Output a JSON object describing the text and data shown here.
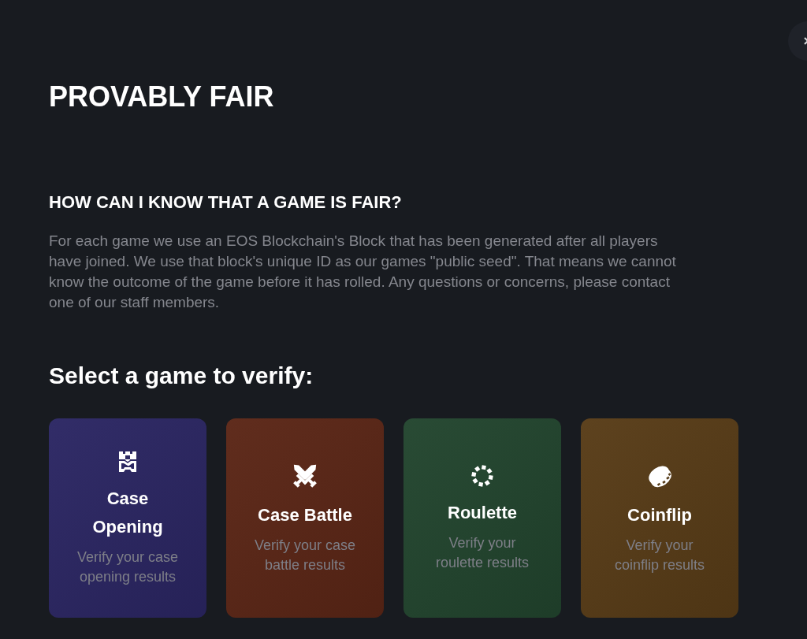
{
  "page": {
    "title": "PROVABLY FAIR"
  },
  "faq": {
    "heading": "HOW CAN I KNOW THAT A GAME IS FAIR?",
    "body": "For each game we use an EOS Blockchain's Block that has been generated after all players have joined. We use that block's unique ID as our games \"public seed\". That means we cannot know the outcome of the game before it has rolled. Any questions or concerns, please contact one of our staff members."
  },
  "games_heading": "Select a game to verify:",
  "games": [
    {
      "kind": "case",
      "title": "Case Opening",
      "description": "Verify your case opening results",
      "color": "#2b2663"
    },
    {
      "kind": "battle",
      "title": "Case Battle",
      "description": "Verify your case battle results",
      "color": "#5b2616"
    },
    {
      "kind": "roulette",
      "title": "Roulette",
      "description": "Verify your roulette results",
      "color": "#22452e"
    },
    {
      "kind": "coinflip",
      "title": "Coinflip",
      "description": "Verify your coinflip results",
      "color": "#583c17"
    }
  ]
}
